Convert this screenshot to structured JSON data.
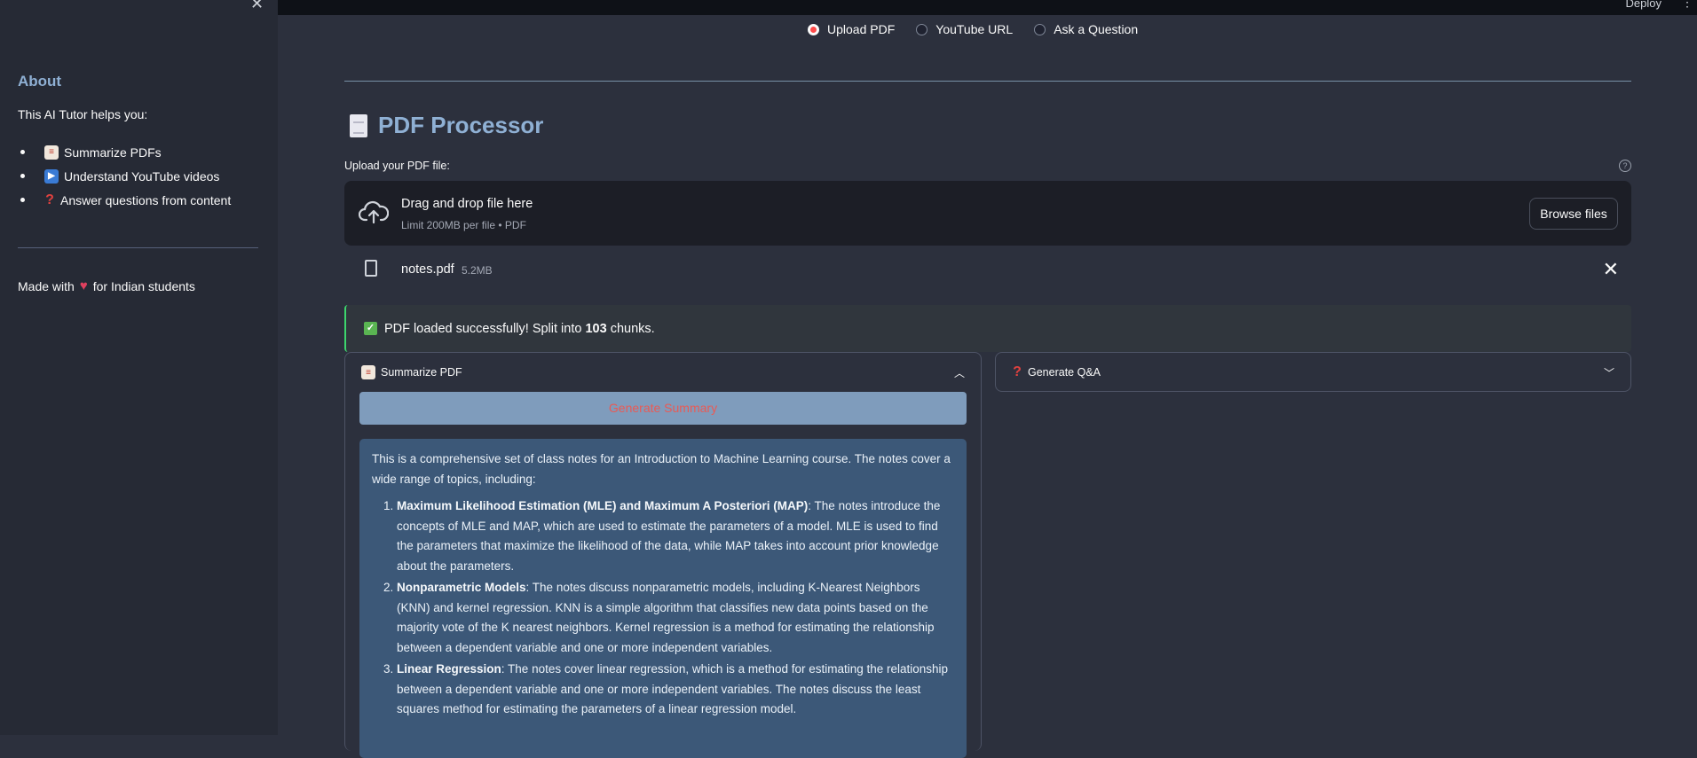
{
  "sidebar": {
    "about_title": "About",
    "description": "This AI Tutor helps you:",
    "features": [
      {
        "icon": "memo-icon",
        "label": "Summarize PDFs"
      },
      {
        "icon": "play-button-icon",
        "label": "Understand YouTube videos"
      },
      {
        "icon": "question-mark-icon",
        "label": "Answer questions from content"
      }
    ],
    "made_with_prefix": "Made with",
    "made_with_suffix": "for Indian students"
  },
  "topbar": {
    "deploy_label": "Deploy"
  },
  "modes": {
    "options": [
      "Upload PDF",
      "YouTube URL",
      "Ask a Question"
    ],
    "selected": "Upload PDF"
  },
  "page_title": "PDF Processor",
  "uploader": {
    "label": "Upload your PDF file:",
    "drop_title": "Drag and drop file here",
    "limit_text": "Limit 200MB per file • PDF",
    "browse_label": "Browse files"
  },
  "file": {
    "name": "notes.pdf",
    "size": "5.2MB"
  },
  "status": {
    "prefix": "PDF loaded successfully! Split into",
    "chunks": "103",
    "suffix": "chunks."
  },
  "summarize": {
    "header": "Summarize PDF",
    "button_label": "Generate Summary",
    "intro": "This is a comprehensive set of class notes for an Introduction to Machine Learning course. The notes cover a wide range of topics, including:",
    "items": [
      {
        "title": "Maximum Likelihood Estimation (MLE) and Maximum A Posteriori (MAP)",
        "text": ": The notes introduce the concepts of MLE and MAP, which are used to estimate the parameters of a model. MLE is used to find the parameters that maximize the likelihood of the data, while MAP takes into account prior knowledge about the parameters."
      },
      {
        "title": "Nonparametric Models",
        "text": ": The notes discuss nonparametric models, including K-Nearest Neighbors (KNN) and kernel regression. KNN is a simple algorithm that classifies new data points based on the majority vote of the K nearest neighbors. Kernel regression is a method for estimating the relationship between a dependent variable and one or more independent variables."
      },
      {
        "title": "Linear Regression",
        "text": ": The notes cover linear regression, which is a method for estimating the relationship between a dependent variable and one or more independent variables. The notes discuss the least squares method for estimating the parameters of a linear regression model."
      }
    ]
  },
  "qa": {
    "header": "Generate Q&A"
  },
  "colors": {
    "accent": "#ff4b4b",
    "heading": "#8fb0d4",
    "summary_bg": "#3c5878",
    "button_bg": "#7f9cbc"
  }
}
